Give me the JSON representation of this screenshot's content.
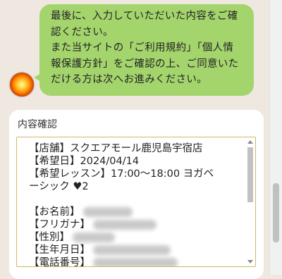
{
  "chat": {
    "message": "最後に、入力していただいた内容をご確\n認ください。\nまた当サイトの「ご利用規約」「個人情\n報保護方針」をご確認の上、ご同意いた\nだける方は次へお進みください。"
  },
  "confirmation": {
    "title": "内容確認",
    "lines": {
      "store": "【店舗】スクエアモール鹿児島宇宿店",
      "date": "【希望日】2024/04/14",
      "lesson_1": "【希望レッスン】17:00～18:00 ヨガベ",
      "lesson_2": "ーシック ♥2",
      "name": "【お名前】",
      "furigana": "【フリガナ】",
      "gender": "【性別】",
      "birthday": "【生年月日】",
      "phone": "【電話番号】"
    }
  },
  "colors": {
    "background": "#efe8e0",
    "bubble": "#a4d56d",
    "box_border": "#d6b26a"
  }
}
